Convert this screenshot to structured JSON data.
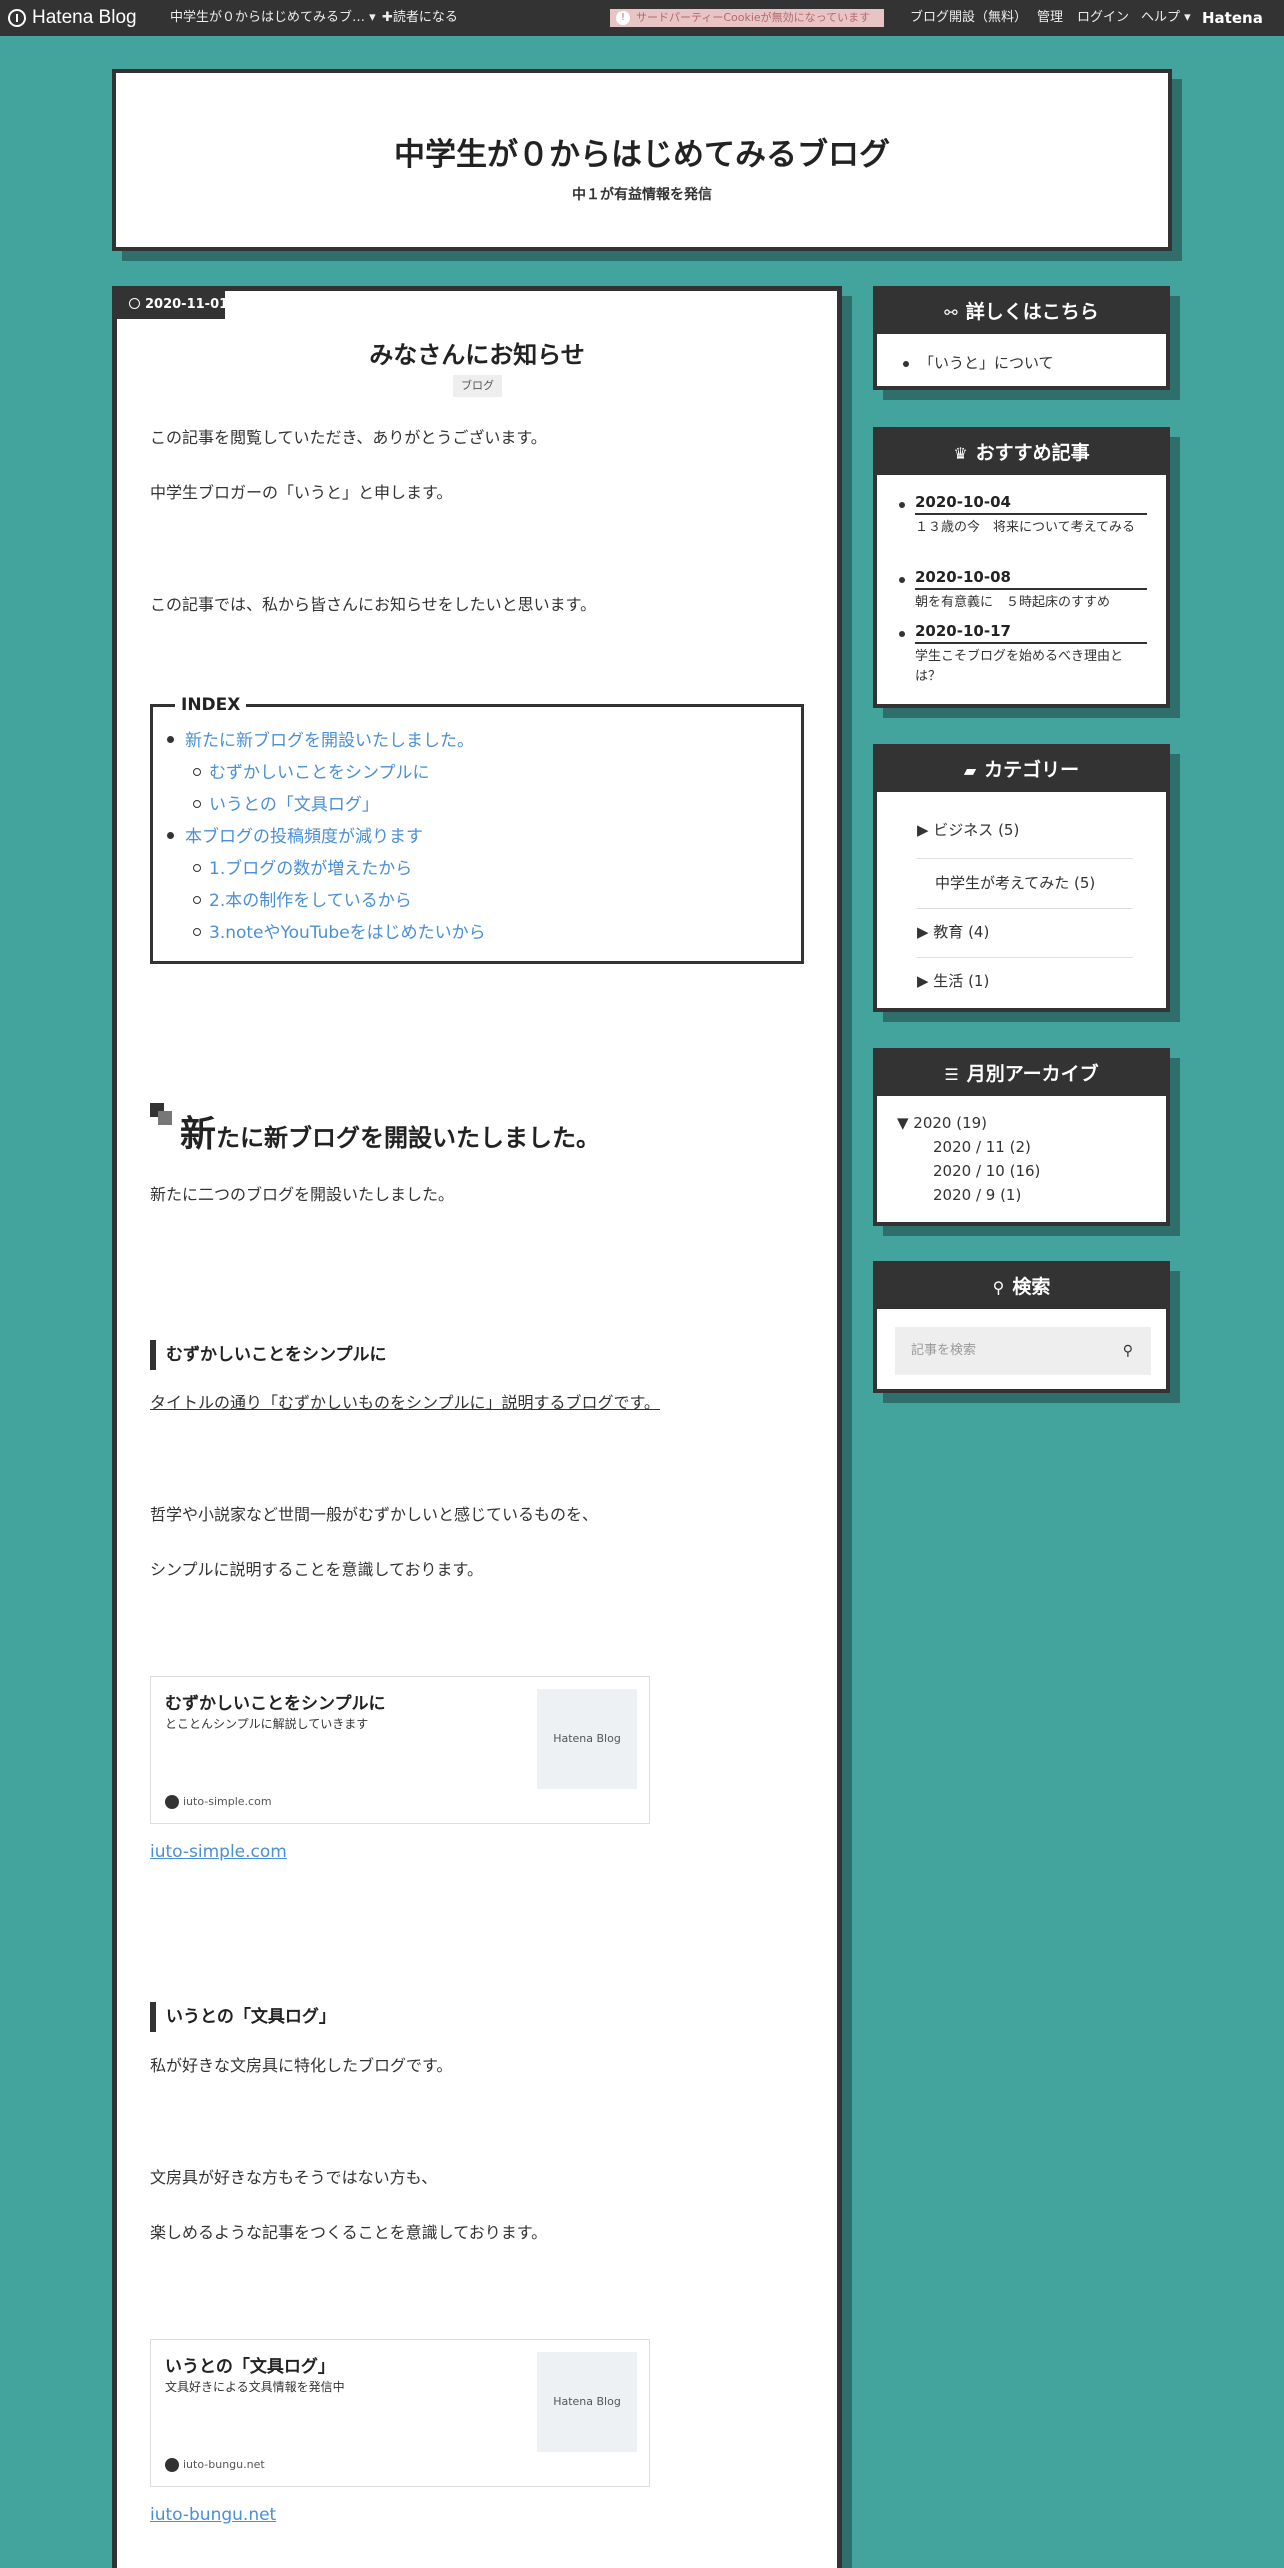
{
  "topbar": {
    "logo": "Hatena Blog",
    "blog_menu": "中学生が０からはじめてみるブ… ▾",
    "reader": "✚読者になる",
    "cookie_notice": "サードパーティーCookieが無効になっています",
    "open_blog": "ブログ開設（無料）",
    "admin": "管理",
    "login": "ログイン",
    "help": "ヘルプ ▾",
    "hatena": "Hatena"
  },
  "header": {
    "title": "中学生が０からはじめてみるブログ",
    "description": "中１が有益情報を発信"
  },
  "entry": {
    "date": "2020-11-01",
    "title": "みなさんにお知らせ",
    "category": "ブログ",
    "p1": "この記事を閲覧していただき、ありがとうございます。",
    "p2": "中学生ブロガーの「いうと」と申します。",
    "p3": "この記事では、私から皆さんにお知らせをしたいと思います。",
    "toc": {
      "title": "INDEX",
      "items": [
        "新たに新ブログを開設いたしました。",
        "むずかしいことをシンプルに",
        "いうとの「文具ログ」",
        "本ブログの投稿頻度が減ります",
        "1.ブログの数が増えたから",
        "2.本の制作をしているから",
        "3.noteやYouTubeをはじめたいから"
      ]
    },
    "section1": {
      "heading_first": "新",
      "heading_rest": "たに新ブログを開設いたしました。",
      "text": "新たに二つのブログを開設いたしました。"
    },
    "blog1": {
      "heading": "むずかしいことをシンプルに",
      "underline": "タイトルの通り「むずかしいものをシンプルに」説明するブログです。",
      "p1": "哲学や小説家など世間一般がむずかしいと感じているものを、",
      "p2": "シンプルに説明することを意識しております。",
      "card_title": "むずかしいことをシンプルに",
      "card_desc": "とことんシンプルに解説していきます",
      "card_thumb": "Hatena Blog",
      "card_url": "iuto-simple.com",
      "link": "iuto-simple.com"
    },
    "blog2": {
      "heading": "いうとの「文具ログ」",
      "p0": "私が好きな文房具に特化したブログです。",
      "p1": "文房具が好きな方もそうではない方も、",
      "p2": "楽しめるような記事をつくることを意識しております。",
      "card_title": "いうとの「文具ログ」",
      "card_desc": "文具好きによる文具情報を発信中",
      "card_thumb": "Hatena Blog",
      "card_url": "iuto-bungu.net",
      "link": "iuto-bungu.net"
    }
  },
  "sidebar": {
    "about": {
      "title": "詳しくはこちら",
      "item": "「いうと」について"
    },
    "recommended": {
      "title": "おすすめ記事",
      "items": [
        {
          "date": "2020-10-04",
          "text": "１３歳の今　将来について考えてみる"
        },
        {
          "date": "2020-10-08",
          "text": "朝を有意義に　５時起床のすすめ"
        },
        {
          "date": "2020-10-17",
          "text": "学生こそブログを始めるべき理由とは？"
        }
      ]
    },
    "categories": {
      "title": "カテゴリー",
      "items": [
        "▶ ビジネス (5)",
        "中学生が考えてみた (5)",
        "▶ 教育 (4)",
        "▶ 生活 (1)"
      ]
    },
    "archive": {
      "title": "月別アーカイブ",
      "year": "▼ 2020 (19)",
      "months": [
        "2020 / 11 (2)",
        "2020 / 10 (16)",
        "2020 / 9 (1)"
      ]
    },
    "search": {
      "title": "検索",
      "placeholder": "記事を検索"
    }
  }
}
